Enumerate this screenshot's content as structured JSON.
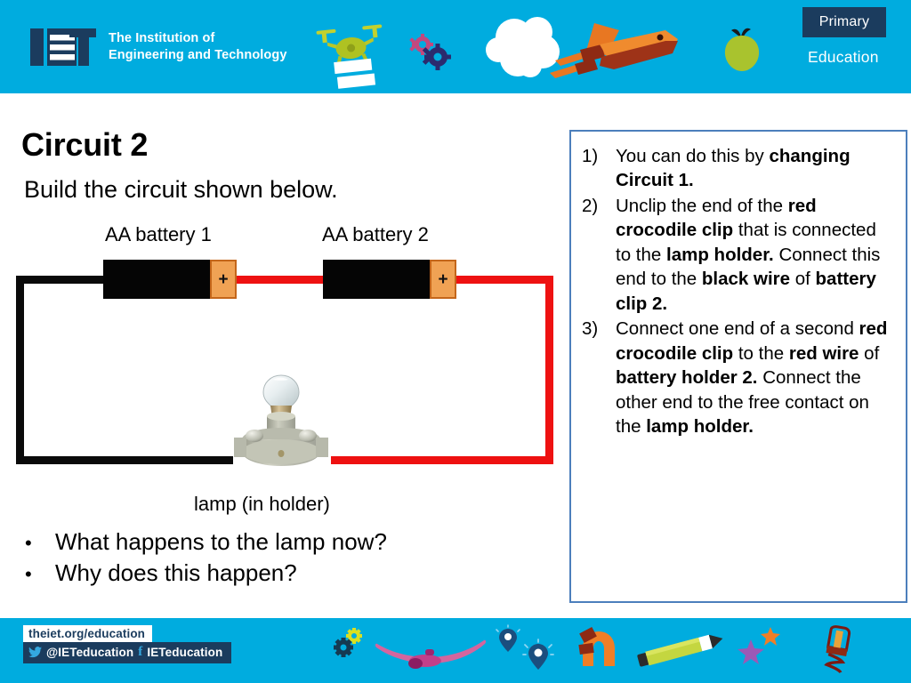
{
  "header": {
    "logo_tagline_line1": "The Institution of",
    "logo_tagline_line2": "Engineering and Technology",
    "primary_badge": "Primary",
    "education_label": "Education",
    "brand_cyan": "#00ACDF",
    "brand_navy": "#1B3C5E",
    "icons": [
      "drone-icon",
      "gears-icon",
      "cloud-icon",
      "space-shuttle-icon",
      "apple-icon"
    ]
  },
  "main": {
    "title": "Circuit 2",
    "subtitle": "Build the circuit shown below.",
    "battery_label_1": "AA battery 1",
    "battery_label_2": "AA battery 2",
    "lamp_label": "lamp (in holder)",
    "questions": [
      {
        "bullet": "•",
        "text": "What happens to the lamp now?"
      },
      {
        "bullet": "•",
        "text": "Why does this happen?"
      }
    ],
    "circuit": {
      "battery_terminal_symbol": "+",
      "black_wire_color": "#0A0A0A",
      "red_wire_color": "#EE1111",
      "battery_body_color": "#050505",
      "battery_terminal_color": "#F0A254"
    }
  },
  "instructions": {
    "border_color": "#4C7FBC",
    "items": [
      {
        "number": "1)",
        "parts": [
          {
            "text": "You can do this by ",
            "bold": false
          },
          {
            "text": "changing Circuit 1.",
            "bold": true
          }
        ]
      },
      {
        "number": "2)",
        "parts": [
          {
            "text": "Unclip the end of the ",
            "bold": false
          },
          {
            "text": "red crocodile clip",
            "bold": true
          },
          {
            "text": " that is connected to the ",
            "bold": false
          },
          {
            "text": "lamp holder.",
            "bold": true
          },
          {
            "text": " Connect this end to the ",
            "bold": false
          },
          {
            "text": "black wire",
            "bold": true
          },
          {
            "text": " of ",
            "bold": false
          },
          {
            "text": "battery clip 2.",
            "bold": true
          }
        ]
      },
      {
        "number": "3)",
        "parts": [
          {
            "text": "Connect one end of a second ",
            "bold": false
          },
          {
            "text": "red crocodile clip",
            "bold": true
          },
          {
            "text": " to the ",
            "bold": false
          },
          {
            "text": "red wire",
            "bold": true
          },
          {
            "text": " of ",
            "bold": false
          },
          {
            "text": "battery holder 2.",
            "bold": true
          },
          {
            "text": " Connect the other end to the free contact on the ",
            "bold": false
          },
          {
            "text": "lamp holder.",
            "bold": true
          }
        ]
      }
    ]
  },
  "footer": {
    "url": "theiet.org/education",
    "twitter_handle": "@IETeducation",
    "facebook_handle": "IETeducation",
    "icons": [
      "gears-icon",
      "plane-icon",
      "map-pin-icon",
      "map-pin-icon",
      "magnet-icon",
      "pencil-icon",
      "stars-icon",
      "lightbulb-icon"
    ]
  }
}
